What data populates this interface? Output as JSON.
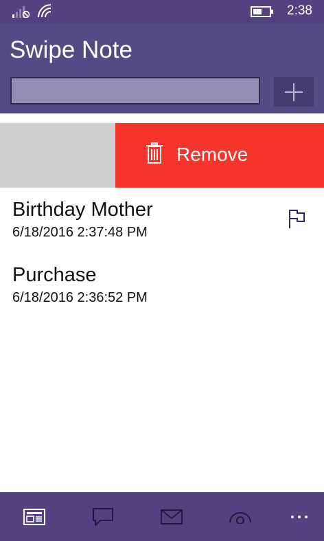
{
  "status_bar": {
    "time": "2:38"
  },
  "header": {
    "title": "Swipe Note",
    "input_value": "",
    "add_button": "+"
  },
  "swipe_action": {
    "remove_label": "Remove"
  },
  "notes": [
    {
      "title": "Birthday Mother",
      "date": "6/18/2016 2:37:48 PM",
      "flagged": true
    },
    {
      "title": "Purchase",
      "date": "6/18/2016 2:36:52 PM",
      "flagged": false
    }
  ],
  "app_bar": {
    "icons": [
      "notes-icon",
      "chat-icon",
      "mail-icon",
      "eye-icon",
      "more-icon"
    ]
  },
  "colors": {
    "header": "#554a86",
    "status_bar": "#50437f",
    "remove": "#f5342b",
    "input": "#948fb4"
  }
}
